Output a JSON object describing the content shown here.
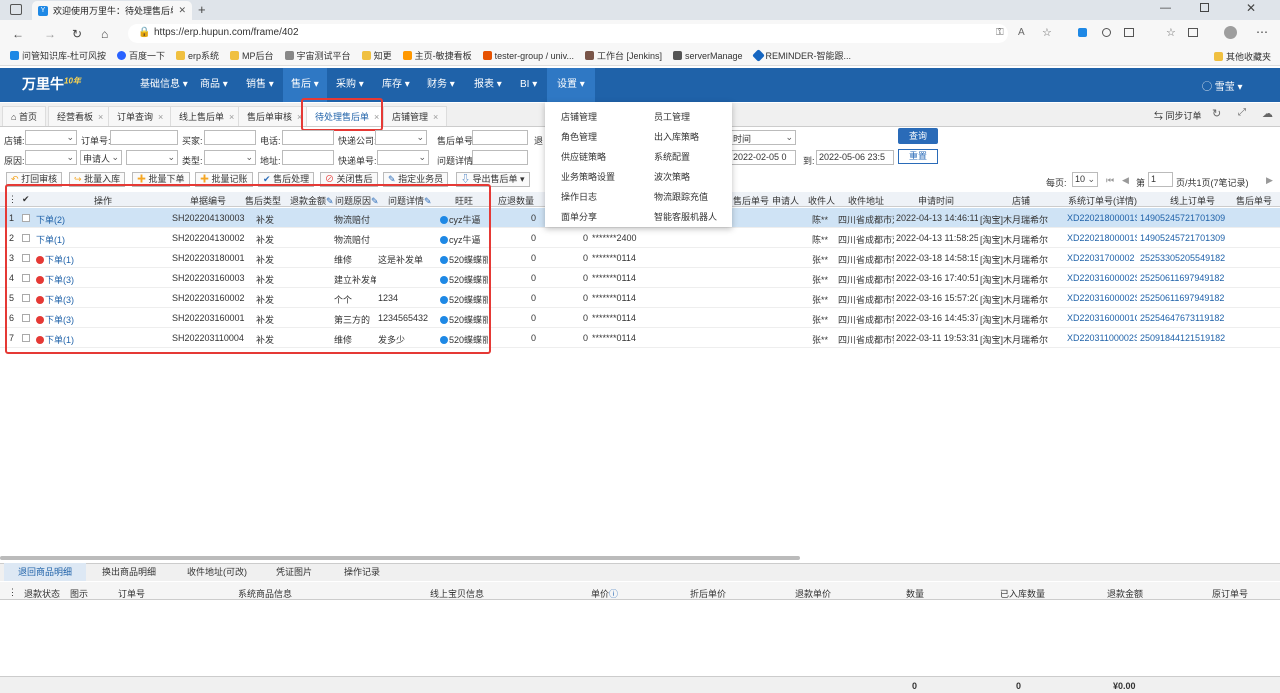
{
  "browser": {
    "tab_title": "欢迎使用万里牛：待处理售后单",
    "url": "https://erp.hupun.com/frame/402"
  },
  "bookmarks": [
    "问管知识库-杜可风按",
    "百度一下",
    "erp系统",
    "MP后台",
    "宇宙测试平台",
    "知更",
    "主页-敏捷看板",
    "tester-group / univ...",
    "工作台 [Jenkins]",
    "serverManage",
    "REMINDER-智能跟...",
    "其他收藏夹"
  ],
  "app": {
    "logo": "万里牛",
    "badge": "10年",
    "user": "雪莹"
  },
  "menu": [
    "基础信息",
    "商品",
    "销售",
    "售后",
    "采购",
    "库存",
    "财务",
    "报表",
    "BI",
    "设置"
  ],
  "page_tabs": [
    {
      "label": "首页"
    },
    {
      "label": "经营看板"
    },
    {
      "label": "订单查询"
    },
    {
      "label": "线上售后单"
    },
    {
      "label": "售后单审核"
    },
    {
      "label": "待处理售后单"
    },
    {
      "label": "店铺管理"
    }
  ],
  "sync_label": "同步订单",
  "filters": {
    "shop": "店铺:",
    "order_no": "订单号:",
    "buyer": "买家:",
    "phone": "电话:",
    "express_co": "快递公司:",
    "after_no": "售后单号:",
    "reason": "原因:",
    "applicant": "申请人",
    "type": "类型:",
    "addr": "地址:",
    "express_no": "快递单号:",
    "problem": "问题详情:",
    "time_label": "时间",
    "date_from": "2022-02-05 0",
    "to": "到:",
    "date_to": "2022-05-06 23:5",
    "query": "查询",
    "reset": "重置",
    "tui": "退"
  },
  "toolbar": [
    "打回审核",
    "批量入库",
    "批量下单",
    "批量记账",
    "售后处理",
    "关闭售后",
    "指定业务员",
    "导出售后单"
  ],
  "pagination": {
    "per_page_label": "每页:",
    "per_page": "10",
    "page_label": "第",
    "page": "1",
    "summary": "页/共1页(7笔记录)"
  },
  "columns": {
    "op": "操作",
    "code": "单据编号",
    "after_type": "售后类型",
    "refund": "退款金额",
    "reason": "问题原因",
    "detail": "问题详情",
    "ww": "旺旺",
    "qty": "应退数量",
    "after_no": "售后单号",
    "applicant": "申请人",
    "receiver": "收件人",
    "addr": "收件地址",
    "apply_time": "申请时间",
    "shop": "店铺",
    "sys_order": "系统订单号(详情)",
    "online_order": "线上订单号",
    "after_no2": "售后单号"
  },
  "rows": [
    {
      "n": "1",
      "op": "下单(2)",
      "code": "SH202204130003",
      "type": "补发",
      "reason": "物流赔付",
      "detail": "",
      "ww": "cyz牛逼",
      "qty": "0",
      "refund": "",
      "masked": "",
      "recv": "陈**",
      "addr": "四川省成都市双",
      "time": "2022-04-13 14:46:11",
      "shop": "[淘宝]木月瑞希尔",
      "sys": "XD22021800001S",
      "online": "14905245721701309"
    },
    {
      "n": "2",
      "op": "下单(1)",
      "code": "SH202204130002",
      "type": "补发",
      "reason": "物流赔付",
      "detail": "",
      "ww": "cyz牛逼",
      "qty": "0",
      "refund": "0",
      "masked": "*******2400",
      "recv": "陈**",
      "addr": "四川省成都市双",
      "time": "2022-04-13 11:58:25",
      "shop": "[淘宝]木月瑞希尔",
      "sys": "XD22021800001S",
      "online": "14905245721701309"
    },
    {
      "n": "3",
      "op": "下单(1)",
      "code": "SH202203180001",
      "type": "补发",
      "reason": "维修",
      "detail": "这是补发单",
      "ww": "520蝶蝶丽",
      "qty": "0",
      "refund": "0",
      "masked": "*******0114",
      "recv": "张**",
      "addr": "四川省成都市锦",
      "time": "2022-03-18 14:58:15",
      "shop": "[淘宝]木月瑞希尔",
      "sys": "XD22031700002",
      "online": "25253305205549182"
    },
    {
      "n": "4",
      "op": "下单(3)",
      "code": "SH202203160003",
      "type": "补发",
      "reason": "建立补发单",
      "detail": "",
      "ww": "520蝶蝶丽",
      "qty": "0",
      "refund": "0",
      "masked": "*******0114",
      "recv": "张**",
      "addr": "四川省成都市锦",
      "time": "2022-03-16 17:40:51",
      "shop": "[淘宝]木月瑞希尔",
      "sys": "XD22031600002S",
      "online": "25250611697949182"
    },
    {
      "n": "5",
      "op": "下单(3)",
      "code": "SH202203160002",
      "type": "补发",
      "reason": "个个",
      "detail": "1234",
      "ww": "520蝶蝶丽",
      "qty": "0",
      "refund": "0",
      "masked": "*******0114",
      "recv": "张**",
      "addr": "四川省成都市锦",
      "time": "2022-03-16 15:57:20",
      "shop": "[淘宝]木月瑞希尔",
      "sys": "XD22031600002S",
      "online": "25250611697949182"
    },
    {
      "n": "6",
      "op": "下单(3)",
      "code": "SH202203160001",
      "type": "补发",
      "reason": "第三方的",
      "detail": "1234565432",
      "ww": "520蝶蝶丽",
      "qty": "0",
      "refund": "0",
      "masked": "*******0114",
      "recv": "张**",
      "addr": "四川省成都市锦",
      "time": "2022-03-16 14:45:37",
      "shop": "[淘宝]木月瑞希尔",
      "sys": "XD22031600001O",
      "online": "25254647673119182"
    },
    {
      "n": "7",
      "op": "下单(1)",
      "code": "SH202203110004",
      "type": "补发",
      "reason": "维修",
      "detail": "发多少",
      "ww": "520蝶蝶丽",
      "qty": "0",
      "refund": "0",
      "masked": "*******0114",
      "recv": "张**",
      "addr": "四川省成都市锦",
      "time": "2022-03-11 19:53:31",
      "shop": "[淘宝]木月瑞希尔",
      "sys": "XD22031100002S",
      "online": "25091844121519182"
    }
  ],
  "dropdown": {
    "col1": [
      "店铺管理",
      "角色管理",
      "供应链策略",
      "业务策略设置",
      "操作日志",
      "面单分享"
    ],
    "col2": [
      "员工管理",
      "出入库策略",
      "系统配置",
      "波次策略",
      "物流跟踪充值",
      "智能客服机器人"
    ]
  },
  "bottom_tabs": [
    "退回商品明细",
    "换出商品明细",
    "收件地址(可改)",
    "凭证图片",
    "操作记录"
  ],
  "bottom_cols": [
    "退款状态",
    "图示",
    "订单号",
    "系统商品信息",
    "线上宝贝信息",
    "单价",
    "折后单价",
    "退款单价",
    "数量",
    "已入库数量",
    "退款金额",
    "原订单号"
  ],
  "bottom_totals": {
    "qty": "0",
    "stored": "0",
    "amount": "¥0.00"
  },
  "colors": {
    "nav": "#1f62a9",
    "highlight": "#e53935",
    "selected_row": "#cfe3f5"
  }
}
